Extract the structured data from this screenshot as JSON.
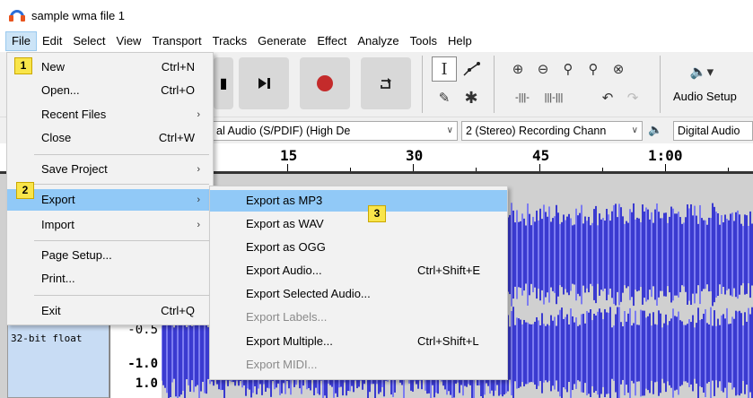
{
  "window": {
    "title": "sample wma file 1"
  },
  "menubar": [
    "File",
    "Edit",
    "Select",
    "View",
    "Transport",
    "Tracks",
    "Generate",
    "Effect",
    "Analyze",
    "Tools",
    "Help"
  ],
  "toolbar": {
    "audio_setup_label": "Audio Setup"
  },
  "devices": {
    "playback": "al Audio (S/PDIF) (High De",
    "channels": "2 (Stereo) Recording Chann",
    "recording": "Digital Audio"
  },
  "ruler": {
    "labels": [
      "15",
      "30",
      "45",
      "1:00"
    ]
  },
  "track": {
    "info_line1": "32-bit float",
    "scale": [
      "-0.5",
      "-1.0",
      "1.0"
    ]
  },
  "file_menu": {
    "items": [
      {
        "label": "New",
        "shortcut": "Ctrl+N"
      },
      {
        "label": "Open...",
        "shortcut": "Ctrl+O"
      },
      {
        "label": "Recent Files",
        "shortcut": ""
      },
      {
        "label": "Close",
        "shortcut": "Ctrl+W"
      },
      {
        "label": "Save Project",
        "shortcut": ""
      },
      {
        "label": "Export",
        "shortcut": ""
      },
      {
        "label": "Import",
        "shortcut": ""
      },
      {
        "label": "Page Setup...",
        "shortcut": ""
      },
      {
        "label": "Print...",
        "shortcut": ""
      },
      {
        "label": "Exit",
        "shortcut": "Ctrl+Q"
      }
    ]
  },
  "export_menu": {
    "items": [
      {
        "label": "Export as MP3",
        "shortcut": ""
      },
      {
        "label": "Export as WAV",
        "shortcut": ""
      },
      {
        "label": "Export as OGG",
        "shortcut": ""
      },
      {
        "label": "Export Audio...",
        "shortcut": "Ctrl+Shift+E"
      },
      {
        "label": "Export Selected Audio...",
        "shortcut": ""
      },
      {
        "label": "Export Labels...",
        "shortcut": ""
      },
      {
        "label": "Export Multiple...",
        "shortcut": "Ctrl+Shift+L"
      },
      {
        "label": "Export MIDI...",
        "shortcut": ""
      }
    ]
  },
  "badges": [
    "1",
    "2",
    "3"
  ],
  "colors": {
    "highlight": "#91c9f7",
    "waveform": "#4b4bd8",
    "badge": "#f9e54a",
    "record": "#c42b2b"
  },
  "icons": [
    "audacity-logo-icon",
    "skip-end-icon",
    "record-icon",
    "loop-icon",
    "selection-tool-icon",
    "envelope-tool-icon",
    "draw-tool-icon",
    "multi-tool-icon",
    "zoom-in-icon",
    "zoom-out-icon",
    "fit-selection-icon",
    "fit-project-icon",
    "zoom-toggle-icon",
    "trim-icon",
    "silence-icon",
    "undo-icon",
    "redo-icon",
    "speaker-icon"
  ]
}
